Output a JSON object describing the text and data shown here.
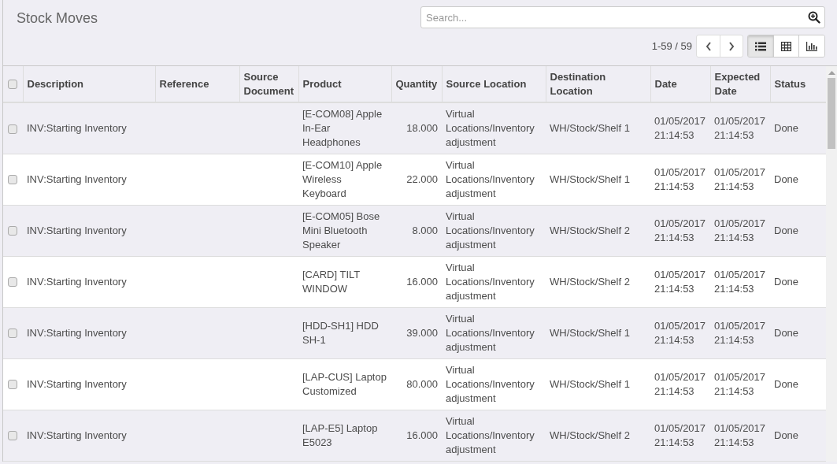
{
  "title": "Stock Moves",
  "search": {
    "placeholder": "Search..."
  },
  "pager": {
    "range": "1-59 / 59"
  },
  "views": [
    {
      "kind": "list",
      "selected": true
    },
    {
      "kind": "grid",
      "selected": false
    },
    {
      "kind": "graph",
      "selected": false
    }
  ],
  "table": {
    "select_all": {
      "checked": false
    },
    "columns": [
      "Description",
      "Reference",
      "Source Document",
      "Product",
      "Quantity",
      "Source Location",
      "Destination Location",
      "Date",
      "Expected Date",
      "Status"
    ],
    "rows": [
      {
        "checked": false,
        "description": "INV:Starting Inventory",
        "product": "[E-COM08] Apple In-Ear Headphones",
        "quantity": "18.000",
        "source_location": "Virtual Locations/Inventory adjustment",
        "destination_location": "WH/Stock/Shelf 1",
        "date": "01/05/2017 21:14:53",
        "expected_date": "01/05/2017 21:14:53",
        "status": "Done"
      },
      {
        "checked": false,
        "description": "INV:Starting Inventory",
        "product": "[E-COM10] Apple Wireless Keyboard",
        "quantity": "22.000",
        "source_location": "Virtual Locations/Inventory adjustment",
        "destination_location": "WH/Stock/Shelf 1",
        "date": "01/05/2017 21:14:53",
        "expected_date": "01/05/2017 21:14:53",
        "status": "Done"
      },
      {
        "checked": false,
        "description": "INV:Starting Inventory",
        "product": "[E-COM05] Bose Mini Bluetooth Speaker",
        "quantity": "8.000",
        "source_location": "Virtual Locations/Inventory adjustment",
        "destination_location": "WH/Stock/Shelf 2",
        "date": "01/05/2017 21:14:53",
        "expected_date": "01/05/2017 21:14:53",
        "status": "Done"
      },
      {
        "checked": false,
        "description": "INV:Starting Inventory",
        "product": "[CARD] TILT WINDOW",
        "quantity": "16.000",
        "source_location": "Virtual Locations/Inventory adjustment",
        "destination_location": "WH/Stock/Shelf 2",
        "date": "01/05/2017 21:14:53",
        "expected_date": "01/05/2017 21:14:53",
        "status": "Done"
      },
      {
        "checked": false,
        "description": "INV:Starting Inventory",
        "product": "[HDD-SH1] HDD SH-1",
        "quantity": "39.000",
        "source_location": "Virtual Locations/Inventory adjustment",
        "destination_location": "WH/Stock/Shelf 1",
        "date": "01/05/2017 21:14:53",
        "expected_date": "01/05/2017 21:14:53",
        "status": "Done"
      },
      {
        "checked": false,
        "description": "INV:Starting Inventory",
        "product": "[LAP-CUS] Laptop Customized",
        "quantity": "80.000",
        "source_location": "Virtual Locations/Inventory adjustment",
        "destination_location": "WH/Stock/Shelf 1",
        "date": "01/05/2017 21:14:53",
        "expected_date": "01/05/2017 21:14:53",
        "status": "Done"
      },
      {
        "checked": false,
        "description": "INV:Starting Inventory",
        "product": "[LAP-E5] Laptop E5023",
        "quantity": "16.000",
        "source_location": "Virtual Locations/Inventory adjustment",
        "destination_location": "WH/Stock/Shelf 2",
        "date": "01/05/2017 21:14:53",
        "expected_date": "01/05/2017 21:14:53",
        "status": "Done"
      }
    ]
  }
}
